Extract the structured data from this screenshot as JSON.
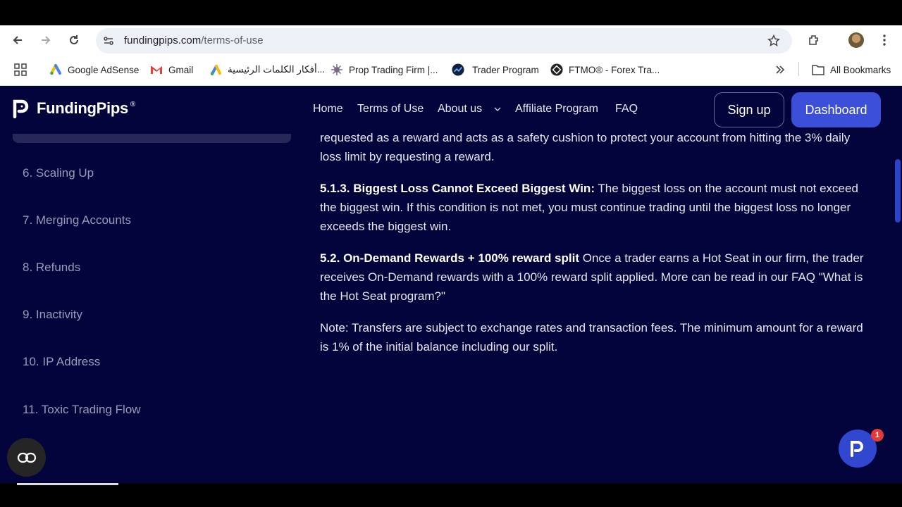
{
  "browser": {
    "url_domain": "fundingpips.com",
    "url_path": "/terms-of-use",
    "bookmarks": [
      {
        "label": "Google AdSense",
        "icon": "adsense-icon"
      },
      {
        "label": "Gmail",
        "icon": "gmail-icon"
      },
      {
        "label": "أفكار الكلمات الرئيسية...",
        "icon": "google-ads-icon"
      },
      {
        "label": "Prop Trading Firm |...",
        "icon": "prop-firm-icon"
      },
      {
        "label": "Trader Program",
        "icon": "trader-program-icon"
      },
      {
        "label": "FTMO® - Forex Tra...",
        "icon": "ftmo-icon"
      }
    ],
    "all_bookmarks": "All Bookmarks"
  },
  "site": {
    "logo_text": "FundingPips",
    "logo_mark": "®",
    "nav": [
      "Home",
      "Terms of Use",
      "About us",
      "Affiliate Program",
      "FAQ"
    ],
    "signup": "Sign up",
    "dashboard": "Dashboard"
  },
  "toc": [
    "6. Scaling Up",
    "7. Merging Accounts",
    "8. Refunds",
    "9. Inactivity",
    "10. IP Address",
    "11. Toxic Trading Flow"
  ],
  "content": {
    "p0": "requested as a reward and acts as a safety cushion to protect your account from hitting the 3% daily loss limit by requesting a reward.",
    "p1_bold": "5.1.3. Biggest Loss Cannot Exceed Biggest Win:",
    "p1_text": " The biggest loss on the account must not exceed the biggest win. If this condition is not met, you must continue trading until the biggest loss no longer exceeds the biggest win.",
    "p2_bold": "5.2. On-Demand Rewards + 100% reward split",
    "p2_text": " Once a trader earns a Hot Seat in our firm, the trader receives On-Demand rewards with a 100% reward split applied. More can be read in our FAQ \"What is the Hot Seat program?\"",
    "p3": "Note: Transfers are subject to exchange rates and transaction fees. The minimum amount for a reward is 1% of the initial balance including our split."
  },
  "chat_badge": "1",
  "colors": {
    "page_bg": "#04043c",
    "accent": "#3c4fd8"
  }
}
